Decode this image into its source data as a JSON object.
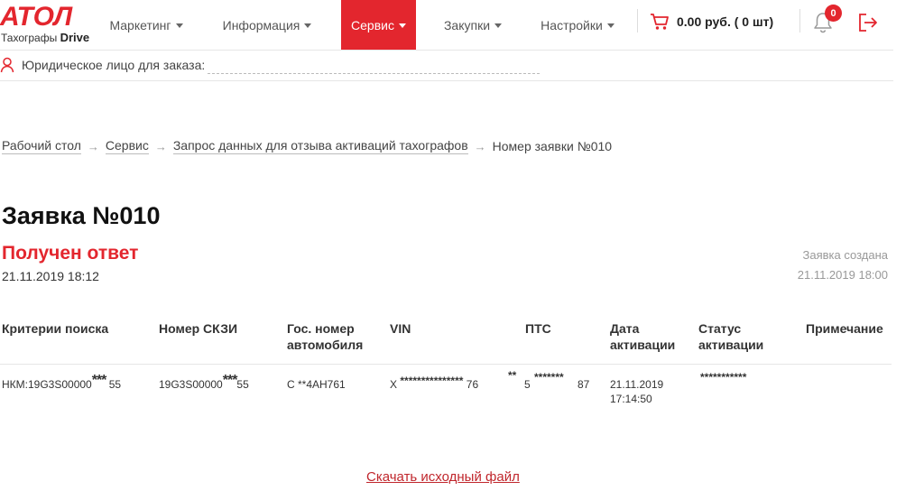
{
  "brand": {
    "logo_text": "АТОЛ",
    "sub_prefix": "Тахографы",
    "sub_bold": "Drive",
    "accent_color": "#e3262e"
  },
  "nav": [
    {
      "label": "Маркетинг",
      "active": false
    },
    {
      "label": "Информация",
      "active": false
    },
    {
      "label": "Сервис",
      "active": true
    },
    {
      "label": "Закупки",
      "active": false
    },
    {
      "label": "Настройки",
      "active": false
    }
  ],
  "cart": {
    "text": "0.00 руб. ( 0  шт)"
  },
  "notifications": {
    "count": "0"
  },
  "legal_entity": {
    "label": "Юридическое лицо для заказа:",
    "value": ""
  },
  "breadcrumb": {
    "items": [
      "Рабочий стол",
      "Сервис",
      "Запрос данных для отзыва активаций тахографов"
    ],
    "current": "Номер заявки №010"
  },
  "request": {
    "title": "Заявка №010",
    "status": "Получен ответ",
    "status_date": "21.11.2019 18:12",
    "created_label": "Заявка создана",
    "created_date": "21.11.2019 18:00"
  },
  "table": {
    "headers": {
      "criteria": "Критерии поиска",
      "skzi": "Номер СКЗИ",
      "plate": "Гос. номер автомобиля",
      "vin": "VIN",
      "pts": "ПТС",
      "act_date": "Дата активации",
      "act_status": "Статус активации",
      "note": "Примечание"
    },
    "row": {
      "criteria_prefix": "НКМ:19G3S00000",
      "criteria_mask": "***",
      "criteria_suffix": "55",
      "skzi_prefix": "19G3S00000",
      "skzi_mask": "***",
      "skzi_suffix": "55",
      "plate": "С **4АН761",
      "vin_prefix": "X",
      "vin_mask": "***************",
      "vin_suffix": "76",
      "pts_mask1": "**",
      "pts_mid": "5",
      "pts_mask2": "*******",
      "pts_suffix": "87",
      "act_date": "21.11.2019",
      "act_time": "17:14:50",
      "act_status": "***********",
      "note": ""
    }
  },
  "download_label": "Скачать исходный файл"
}
